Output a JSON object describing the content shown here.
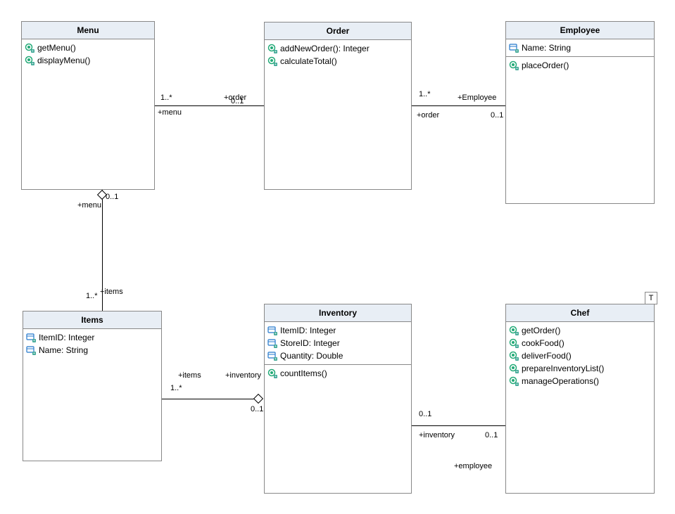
{
  "classes": {
    "menu": {
      "title": "Menu",
      "methods": [
        "getMenu()",
        "displayMenu()"
      ]
    },
    "order": {
      "title": "Order",
      "methods": [
        "addNewOrder(): Integer",
        "calculateTotal()"
      ]
    },
    "employee": {
      "title": "Employee",
      "attrs": [
        "Name: String"
      ],
      "methods": [
        "placeOrder()"
      ]
    },
    "items": {
      "title": "Items",
      "attrs": [
        "ItemID: Integer",
        "Name: String"
      ]
    },
    "inventory": {
      "title": "Inventory",
      "attrs": [
        "ItemID: Integer",
        "StoreID: Integer",
        "Quantity: Double"
      ],
      "methods": [
        "countItems()"
      ]
    },
    "chef": {
      "title": "Chef",
      "methods": [
        "getOrder()",
        "cookFood()",
        "deliverFood()",
        "prepareInventoryList()",
        "manageOperations()"
      ]
    }
  },
  "labels": {
    "mo_left_m": "1..*",
    "mo_left_r": "+menu",
    "mo_right_m": "0..1",
    "mo_right_r": "+order",
    "oe_left_m": "1..*",
    "oe_left_r": "+order",
    "oe_right_m": "0..1",
    "oe_right_r": "+Employee",
    "mi_top_m": "0..1",
    "mi_top_r": "+menu",
    "mi_bot_m": "1..*",
    "mi_bot_r": "+items",
    "ii_left_m": "1..*",
    "ii_left_r": "+items",
    "ii_right_m": "0..1",
    "ii_right_r": "+inventory",
    "ic_left_m": "0..1",
    "ic_left_r": "+inventory",
    "ic_right_m": "0..1",
    "ic_right_r": "+employee"
  },
  "tbox": "T"
}
